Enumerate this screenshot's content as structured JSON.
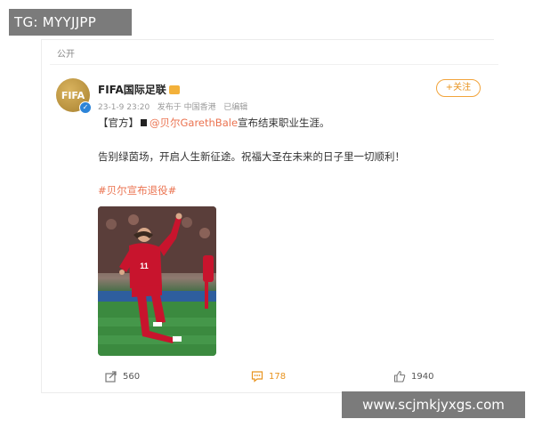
{
  "watermarks": {
    "top": "TG: MYYJJPP",
    "bottom": "www.scjmkjyxgs.com"
  },
  "post": {
    "visibility": "公开",
    "author": "FIFA国际足联",
    "avatar_text": "FIFA",
    "timestamp": "23-1-9 23:20",
    "published_from": "发布于 中国香港",
    "edited": "已编辑",
    "follow_label": "+关注",
    "line1_prefix": "【官方】",
    "line1_mention": "@贝尔GarethBale",
    "line1_suffix": " 宣布结束职业生涯。",
    "line2": "告别绿茵场，开启人生新征途。祝福大圣在未来的日子里一切顺利！",
    "hashtag": "#贝尔宣布退役#",
    "jersey_number": "11"
  },
  "actions": {
    "share_count": "560",
    "comment_count": "178",
    "like_count": "1940"
  },
  "colors": {
    "link": "#eb7350",
    "follow": "#e8931e",
    "jersey_red": "#c8142d",
    "pitch_green": "#3b8a3f"
  }
}
